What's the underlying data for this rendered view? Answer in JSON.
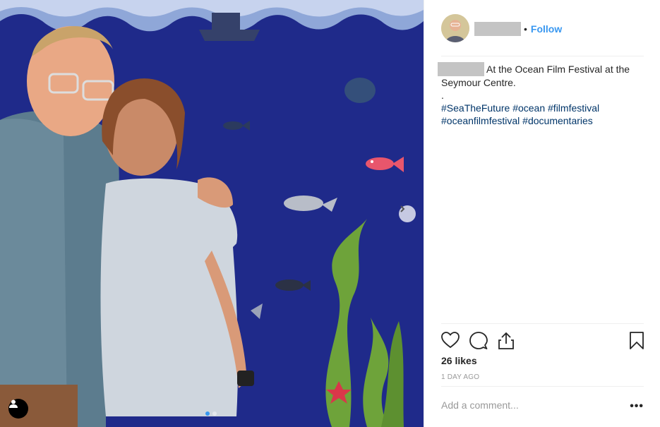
{
  "post": {
    "follow_label": "Follow",
    "bullet": "•",
    "caption_text": "At the Ocean Film Festival at the Seymour Centre.",
    "caption_dot": ".",
    "hashtags": [
      "#SeaTheFuture",
      "#ocean",
      "#filmfestival",
      "#oceanfilmfestival",
      "#documentaries"
    ],
    "likes": "26 likes",
    "date": "1 DAY AGO",
    "comment_placeholder": "Add a comment...",
    "more_label": "•••"
  },
  "carousel": {
    "slide_count": 2,
    "active_index": 0
  },
  "icons": {
    "like": "heart-icon",
    "comment": "comment-icon",
    "share": "share-icon",
    "save": "bookmark-icon",
    "next": "chevron-right-icon",
    "tag": "user-tag-icon"
  },
  "colors": {
    "link": "#3897f0",
    "hashtag": "#003569",
    "muted": "#999999"
  }
}
